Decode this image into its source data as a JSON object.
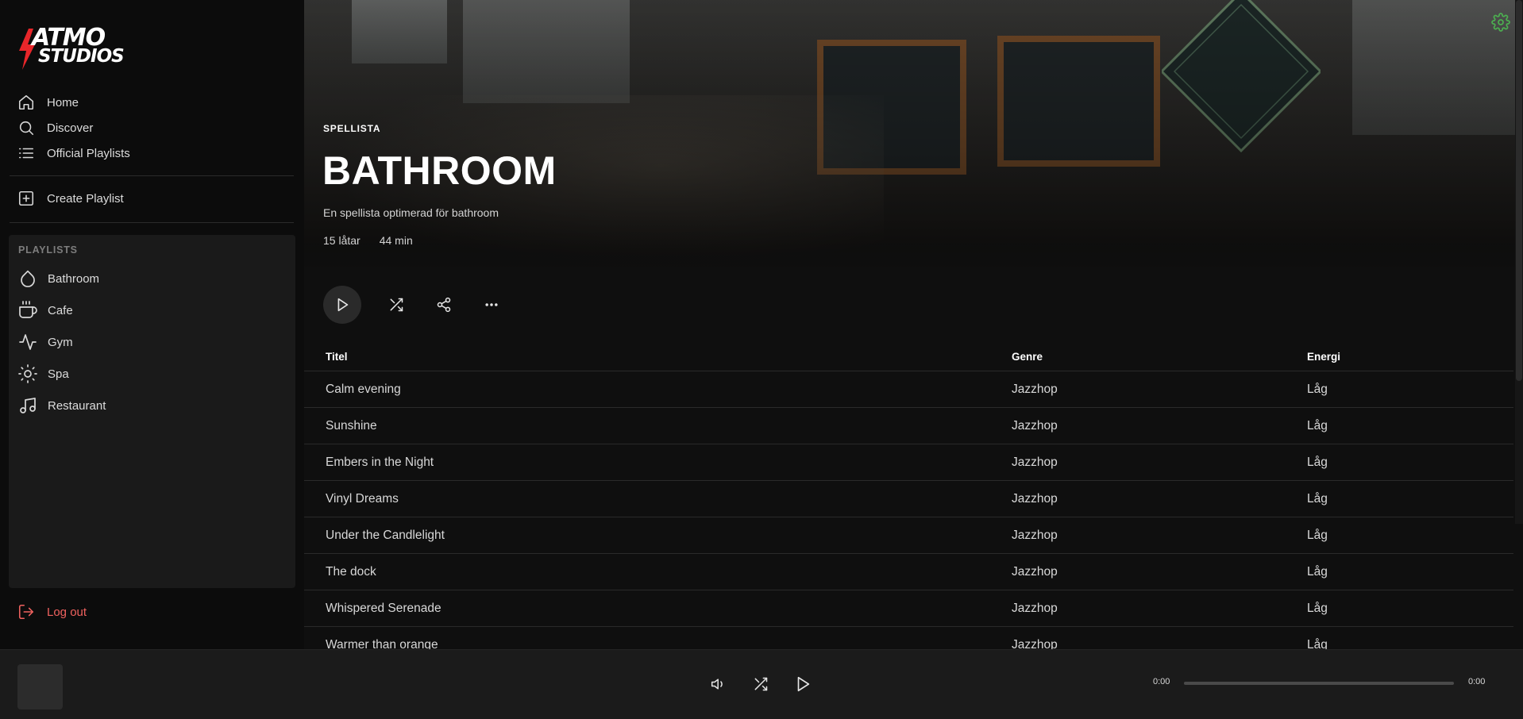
{
  "brand": {
    "line1": "ATMO",
    "line2": "STUDIOS",
    "accent": "#e8262a"
  },
  "nav": [
    {
      "label": "Home",
      "icon": "home-icon"
    },
    {
      "label": "Discover",
      "icon": "search-icon"
    },
    {
      "label": "Official Playlists",
      "icon": "list-icon"
    }
  ],
  "create_playlist": {
    "label": "Create Playlist",
    "icon": "plus-square-icon"
  },
  "playlists": {
    "heading": "PLAYLISTS",
    "items": [
      {
        "label": "Bathroom",
        "icon": "droplet-icon"
      },
      {
        "label": "Cafe",
        "icon": "coffee-icon"
      },
      {
        "label": "Gym",
        "icon": "activity-icon"
      },
      {
        "label": "Spa",
        "icon": "sun-icon"
      },
      {
        "label": "Restaurant",
        "icon": "music-icon"
      }
    ]
  },
  "logout": {
    "label": "Log out",
    "icon": "logout-icon",
    "color": "#f0625f"
  },
  "hero": {
    "eyebrow": "SPELLISTA",
    "title": "BATHROOM",
    "description": "En spellista optimerad för bathroom",
    "track_count": "15 låtar",
    "duration": "44 min",
    "settings_icon": "gear-icon",
    "settings_color": "#4caf50"
  },
  "table": {
    "headers": {
      "title": "Titel",
      "genre": "Genre",
      "energy": "Energi"
    },
    "rows": [
      {
        "title": "Calm evening",
        "genre": "Jazzhop",
        "energy": "Låg"
      },
      {
        "title": "Sunshine",
        "genre": "Jazzhop",
        "energy": "Låg"
      },
      {
        "title": "Embers in the Night",
        "genre": "Jazzhop",
        "energy": "Låg"
      },
      {
        "title": "Vinyl Dreams",
        "genre": "Jazzhop",
        "energy": "Låg"
      },
      {
        "title": "Under the Candlelight",
        "genre": "Jazzhop",
        "energy": "Låg"
      },
      {
        "title": "The dock",
        "genre": "Jazzhop",
        "energy": "Låg"
      },
      {
        "title": "Whispered Serenade",
        "genre": "Jazzhop",
        "energy": "Låg"
      },
      {
        "title": "Warmer than orange",
        "genre": "Jazzhop",
        "energy": "Låg"
      }
    ]
  },
  "player": {
    "elapsed": "0:00",
    "total": "0:00",
    "progress": 0
  }
}
